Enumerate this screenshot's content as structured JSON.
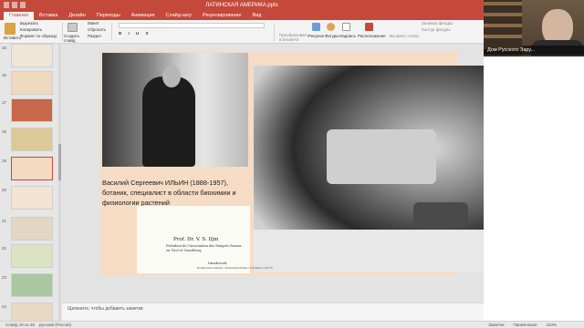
{
  "window": {
    "title": "ЛАТИНСКАЯ АМЕРИКА.pptx"
  },
  "tabs": [
    "Главная",
    "Вставка",
    "Дизайн",
    "Переходы",
    "Анимация",
    "Слайд-шоу",
    "Рецензирование",
    "Вид"
  ],
  "ribbon": {
    "paste": "Вставить",
    "cut": "Вырезать",
    "copy": "Копировать",
    "format": "Формат по образцу",
    "new_slide": "Создать слайд",
    "layout": "Макет",
    "reset": "Сбросить",
    "section": "Раздел",
    "convert": "Преобразовать в SmartArt",
    "pictures": "Рисунок",
    "shapes": "Фигуры",
    "textbox": "Надпись",
    "arrange": "Расположение",
    "quick_styles": "Экспресс-стили",
    "fill": "Заливка фигуры",
    "outline": "Контур фигуры"
  },
  "thumbnails": [
    {
      "num": "15"
    },
    {
      "num": "16"
    },
    {
      "num": "17"
    },
    {
      "num": "18"
    },
    {
      "num": "19",
      "selected": true
    },
    {
      "num": "20"
    },
    {
      "num": "21"
    },
    {
      "num": "22"
    },
    {
      "num": "23"
    },
    {
      "num": "24"
    }
  ],
  "slide": {
    "caption": "Василий Сергеевич ИЛЬИН (1888-1957), ботаник, специалист в области биохимии и физиологии растений",
    "card": {
      "name": "Prof. Dr. V. S. Iljin",
      "line1": "Président de l'Association des Emigrés Russes",
      "line2": "en Tirol et Vorarlberg",
      "city": "Innsbruck",
      "address": "Botanisches Institut, Sternwartestraße 15  Telefon 3-26-75"
    }
  },
  "notes": "Щелкните, чтобы добавить заметки",
  "status": {
    "slide": "Слайд 19 из 38",
    "lang": "русский (Россия)",
    "notes_btn": "Заметки",
    "comments_btn": "Примечания",
    "zoom": "163%"
  },
  "video": {
    "name": "Дом Русского Зару..."
  }
}
